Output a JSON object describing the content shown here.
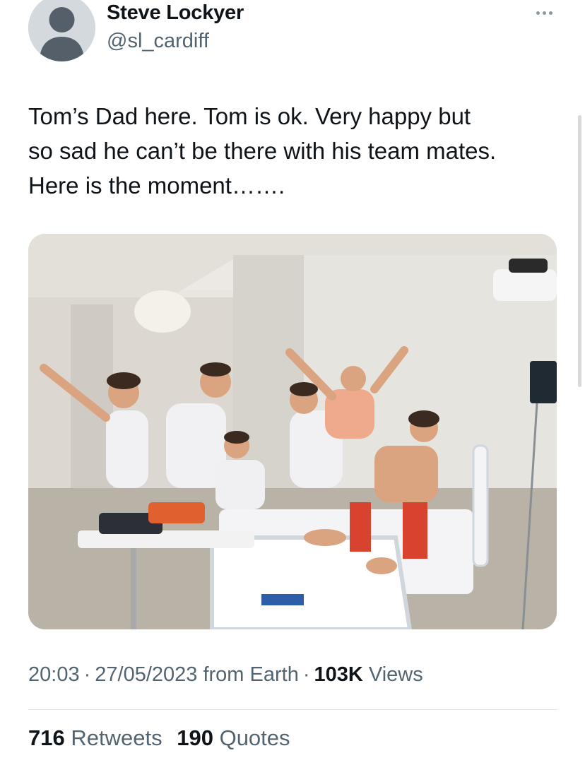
{
  "author": {
    "display_name": "Steve Lockyer",
    "handle": "@sl_cardiff",
    "avatar_icon": "default-profile-icon"
  },
  "more_icon": "more-horizontal-icon",
  "tweet": {
    "lines": [
      "Tom’s Dad here.  Tom is ok.  Very happy but",
      "so sad he can’t be there with his team mates.",
      "Here is the moment……."
    ]
  },
  "media": {
    "kind": "photo"
  },
  "meta": {
    "time": "20:03",
    "separator": "·",
    "date": "27/05/2023",
    "source": "from Earth",
    "views_count": "103K",
    "views_label": "Views"
  },
  "stats": {
    "retweets_count": "716",
    "retweets_label": "Retweets",
    "quotes_count": "190",
    "quotes_label": "Quotes"
  },
  "colors": {
    "text_primary": "#0f1419",
    "text_secondary": "#536471",
    "divider": "#e1e6ea",
    "avatar_bg": "#d4d9de"
  }
}
